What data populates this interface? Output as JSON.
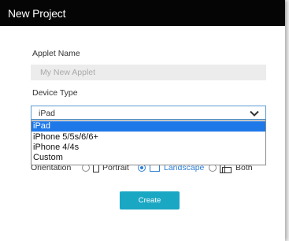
{
  "dialog": {
    "title": "New Project"
  },
  "form": {
    "applet_name_label": "Applet Name",
    "applet_name_placeholder": "My New Applet",
    "device_type_label": "Device Type",
    "device_type_selected": "iPad",
    "device_options": [
      "iPad",
      "iPhone 5/5s/6/6+",
      "iPhone 4/4s",
      "Custom"
    ],
    "orientation_label": "Orientation",
    "orientation_options": [
      {
        "label": "Portrait",
        "checked": false
      },
      {
        "label": "Landscape",
        "checked": true
      },
      {
        "label": "Both",
        "checked": false
      }
    ],
    "create_label": "Create"
  },
  "colors": {
    "title_bar": "#050505",
    "accent_blue": "#2d7fd6",
    "selected_option": "#1e78e8",
    "create_button": "#1aa7c4"
  }
}
